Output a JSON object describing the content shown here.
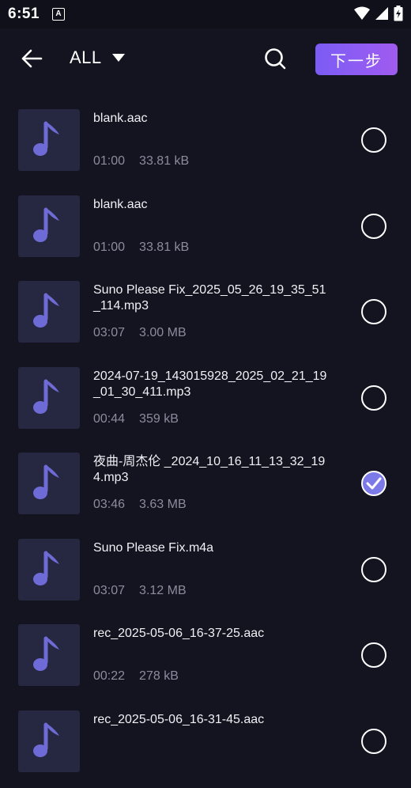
{
  "status_bar": {
    "time": "6:51",
    "notification": "A"
  },
  "app_bar": {
    "filter_label": "ALL",
    "next_label": "下一步"
  },
  "files": [
    {
      "name": "blank.aac",
      "duration": "01:00",
      "size": "33.81 kB",
      "selected": false
    },
    {
      "name": "blank.aac",
      "duration": "01:00",
      "size": "33.81 kB",
      "selected": false
    },
    {
      "name": "Suno Please Fix_2025_05_26_19_35_51_114.mp3",
      "duration": "03:07",
      "size": "3.00 MB",
      "selected": false
    },
    {
      "name": "2024-07-19_143015928_2025_02_21_19_01_30_411.mp3",
      "duration": "00:44",
      "size": "359 kB",
      "selected": false
    },
    {
      "name": "夜曲-周杰伦 _2024_10_16_11_13_32_194.mp3",
      "duration": "03:46",
      "size": "3.63 MB",
      "selected": true
    },
    {
      "name": "Suno Please Fix.m4a",
      "duration": "03:07",
      "size": "3.12 MB",
      "selected": false
    },
    {
      "name": "rec_2025-05-06_16-37-25.aac",
      "duration": "00:22",
      "size": "278 kB",
      "selected": false
    },
    {
      "name": "rec_2025-05-06_16-31-45.aac",
      "duration": "",
      "size": "",
      "selected": false
    }
  ],
  "colors": {
    "background": "#13141f",
    "accent_start": "#7b5cf5",
    "accent_end": "#a05bf0",
    "thumb_bg": "#262842",
    "note_color": "#6f6bd6",
    "meta_text": "#8b8d9e",
    "check_fill": "#7c79e8"
  }
}
